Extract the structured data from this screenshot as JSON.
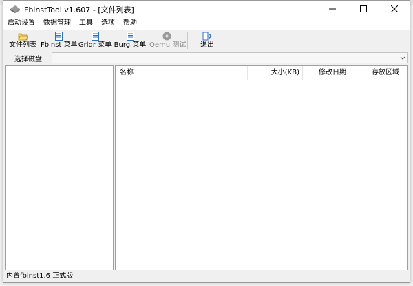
{
  "window": {
    "title": "FbinstTool v1.607 - [文件列表]",
    "controls": {
      "minimize": "—",
      "maximize": "☐",
      "close": "✕"
    }
  },
  "menu": [
    "启动设置",
    "数据管理",
    "工具",
    "选项",
    "帮助"
  ],
  "toolbar": [
    {
      "label": "文件列表",
      "icon": "folder-icon",
      "enabled": true
    },
    {
      "label": "Fbinst 菜单",
      "icon": "list-icon",
      "enabled": true
    },
    {
      "label": "Grldr 菜单",
      "icon": "list-icon",
      "enabled": true
    },
    {
      "label": "Burg 菜单",
      "icon": "list-icon",
      "enabled": true
    },
    {
      "label": "Qemu 测试",
      "icon": "disc-icon",
      "enabled": false
    },
    {
      "label": "退出",
      "icon": "exit-icon",
      "enabled": true
    }
  ],
  "disk": {
    "label": "选择磁盘",
    "value": ""
  },
  "file_table": {
    "columns": [
      "名称",
      "大小(KB)",
      "修改日期",
      "存放区域"
    ],
    "rows": []
  },
  "status": {
    "text": "内置fbinst1.6 正式版"
  },
  "colors": {
    "accent": "#2a6fc9",
    "disabled": "#8a8a8a",
    "folder": "#f2c94c"
  }
}
